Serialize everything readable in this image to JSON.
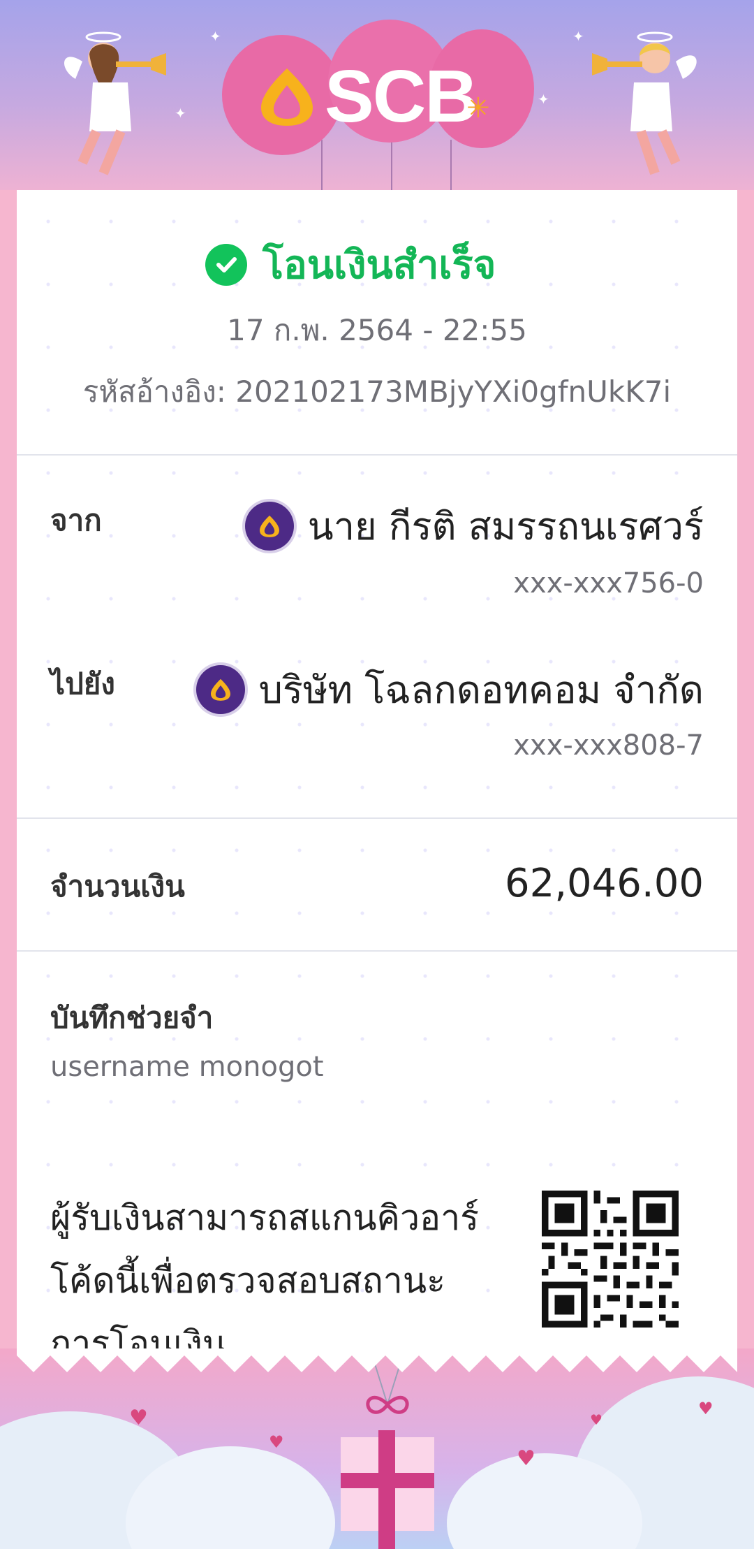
{
  "header": {
    "brand": "SCB",
    "logo_icon": "scb-lotus-icon",
    "decorations": [
      "cupid-left",
      "cupid-right",
      "pink-balloons"
    ]
  },
  "status": {
    "icon": "check-circle-icon",
    "text": "โอนเงินสำเร็จ",
    "datetime": "17 ก.พ. 2564 - 22:55",
    "reference": "รหัสอ้างอิง: 202102173MBjyYXi0gfnUkK7i"
  },
  "from": {
    "label": "จาก",
    "name": "นาย กีรติ สมรรถนเรศวร์",
    "account": "xxx-xxx756-0"
  },
  "to": {
    "label": "ไปยัง",
    "name": "บริษัท โฉลกดอทคอม จำกัด",
    "account": "xxx-xxx808-7"
  },
  "amount": {
    "label": "จำนวนเงิน",
    "value": "62,046.00"
  },
  "memo": {
    "label": "บันทึกช่วยจำ",
    "value": "username monogot"
  },
  "qr_note": "ผู้รับเงินสามารถสแกนคิวอาร์โค้ดนี้เพื่อตรวจสอบสถานะการโอนเงิน",
  "colors": {
    "success": "#13b656",
    "brand_purple": "#4d2a86",
    "header_top": "#a5a3ea",
    "frame_pink": "#f6b6cf"
  }
}
